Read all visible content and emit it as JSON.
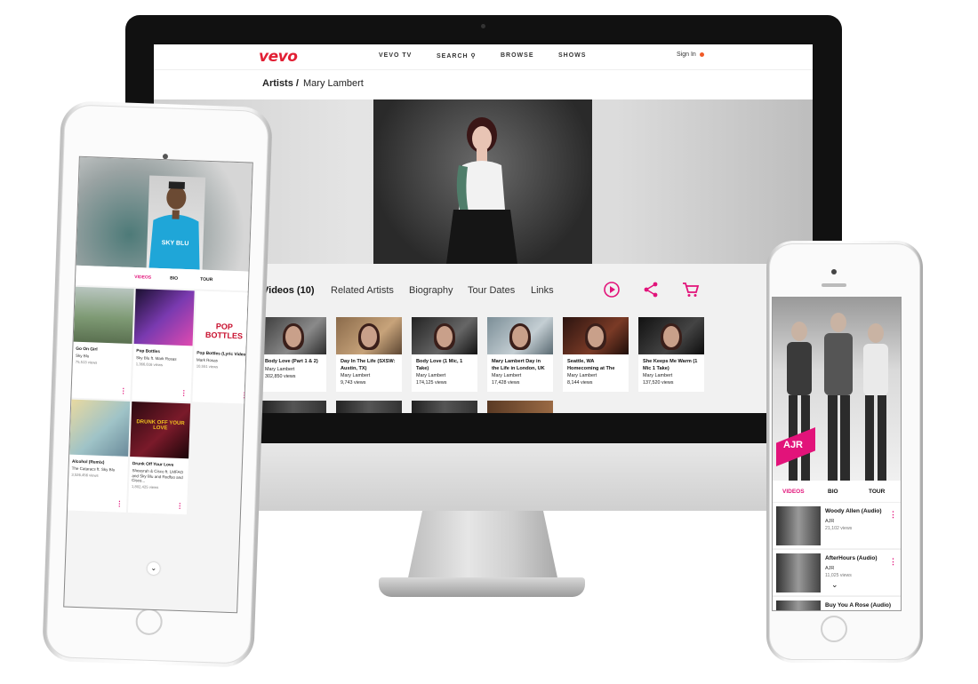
{
  "desktop": {
    "nav": {
      "logo": "vevo",
      "items": [
        "VEVO TV",
        "SEARCH",
        "BROWSE",
        "SHOWS"
      ],
      "sign_in": "Sign In"
    },
    "breadcrumb": {
      "root": "Artists /",
      "current": "Mary Lambert"
    },
    "tabs": [
      "Videos (10)",
      "Related Artists",
      "Biography",
      "Tour Dates",
      "Links"
    ],
    "actions": {
      "play": "play-icon",
      "share": "share-icon",
      "cart": "cart-icon"
    },
    "videos": [
      {
        "title": "Body Love (Part 1 & 2)",
        "artist": "Mary Lambert",
        "views": "302,850 views"
      },
      {
        "title": "Day In The Life (SXSW: Austin, TX)",
        "artist": "Mary Lambert",
        "views": "9,743 views"
      },
      {
        "title": "Body Love (1 Mic, 1 Take)",
        "artist": "Mary Lambert",
        "views": "174,125 views"
      },
      {
        "title": "Mary Lambert Day in the Life in London, UK",
        "artist": "Mary Lambert",
        "views": "17,428 views"
      },
      {
        "title": "Seattle, WA Homecoming at The",
        "artist": "Mary Lambert",
        "views": "8,144 views"
      },
      {
        "title": "She Keeps Me Warm (1 Mic 1 Take)",
        "artist": "Mary Lambert",
        "views": "137,520 views"
      }
    ]
  },
  "tablet": {
    "artist_label": "SKY BLU",
    "tabs": [
      "VIDEOS",
      "BIO",
      "TOUR"
    ],
    "cards": [
      {
        "title": "Go On Girl",
        "meta": "Sky Blu",
        "views": "75,513 views"
      },
      {
        "title": "Pop Bottles",
        "meta": "Sky Blu ft. Mark Rosas",
        "views": "1,366,616 views"
      },
      {
        "title": "Pop Bottles (Lyric Video)",
        "meta": "Mark Rosas",
        "views": "10,551 views",
        "thumb_text": "POP BOTTLES"
      },
      {
        "title": "Alcohol (Remix)",
        "meta": "The Cataracs ft. Sky Blu",
        "views": "3,526,456 views"
      },
      {
        "title": "Drunk Off Your Love",
        "meta": "Sheeyrah & Cisco ft. LMFAO and Sky Blu and Redfoo and Cisco...",
        "views": "1,802,425 views",
        "thumb_text": "DRUNK OFF YOUR LOVE"
      }
    ]
  },
  "phone": {
    "artist_label": "AJR",
    "tabs": [
      "VIDEOS",
      "BIO",
      "TOUR"
    ],
    "rows": [
      {
        "title": "Woody Allen (Audio)",
        "artist": "AJR",
        "views": "21,102 views"
      },
      {
        "title": "AfterHours (Audio)",
        "artist": "AJR",
        "views": "11,025 views"
      },
      {
        "title": "Buy You A Rose (Audio)",
        "artist": "",
        "views": ""
      }
    ]
  },
  "colors": {
    "accent": "#e2137a",
    "brand": "#e21f34"
  }
}
